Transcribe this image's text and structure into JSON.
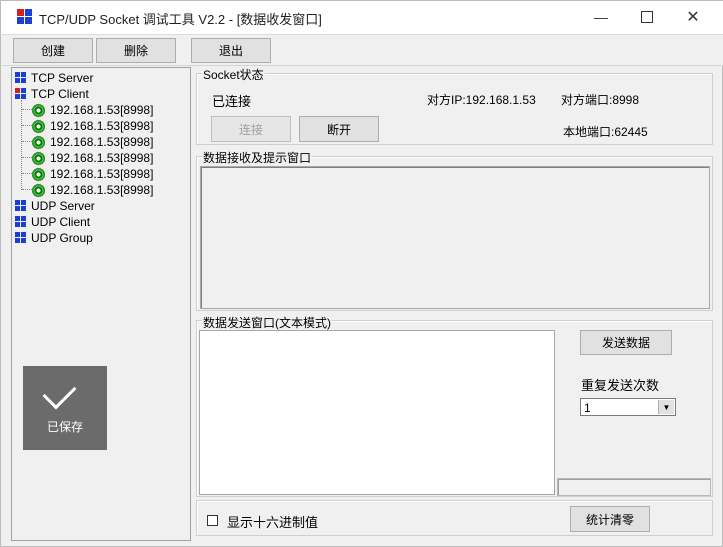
{
  "window": {
    "title": "TCP/UDP Socket 调试工具 V2.2 - [数据收发窗口]"
  },
  "toolbar": {
    "create_label": "创建",
    "delete_label": "删除",
    "exit_label": "退出"
  },
  "tree": {
    "tcp_server": "TCP Server",
    "tcp_client": "TCP Client",
    "clients": [
      "192.168.1.53[8998]",
      "192.168.1.53[8998]",
      "192.168.1.53[8998]",
      "192.168.1.53[8998]",
      "192.168.1.53[8998]",
      "192.168.1.53[8998]"
    ],
    "udp_server": "UDP Server",
    "udp_client": "UDP Client",
    "udp_group": "UDP Group"
  },
  "toast": {
    "text": "已保存",
    "icon": "checkmark-icon"
  },
  "socket_status": {
    "legend": "Socket状态",
    "state": "已连接",
    "peer_ip": "对方IP:192.168.1.53",
    "peer_port": "对方端口:8998",
    "local_port": "本地端口:62445",
    "connect_label": "连接",
    "disconnect_label": "断开"
  },
  "receive": {
    "legend": "数据接收及提示窗口"
  },
  "send": {
    "legend": "数据发送窗口(文本模式)",
    "send_label": "发送数据",
    "repeat_label": "重复发送次数",
    "repeat_value": "1"
  },
  "bottom": {
    "hex_label": "显示十六进制值",
    "clear_stats_label": "统计清零"
  },
  "colors": {
    "icon_blue": "#1a3fd6",
    "icon_red": "#d41f1f",
    "status_green": "#1f8a1f"
  }
}
